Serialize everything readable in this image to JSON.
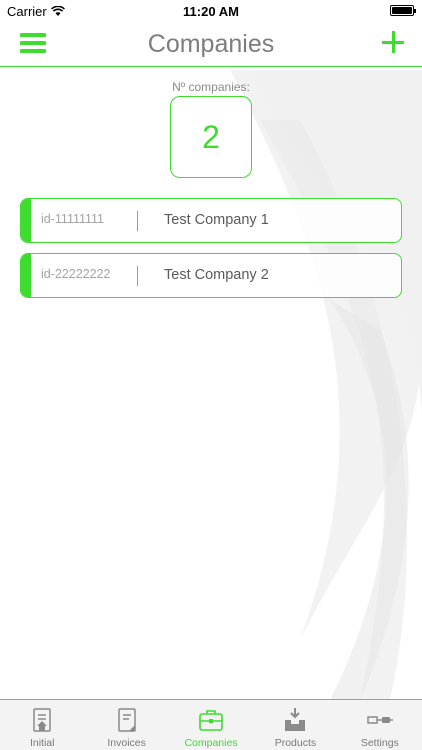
{
  "status_bar": {
    "carrier": "Carrier",
    "time": "11:20 AM"
  },
  "header": {
    "title": "Companies"
  },
  "counter": {
    "label": "Nº companies:",
    "value": "2"
  },
  "companies": [
    {
      "id": "id-11111111",
      "name": "Test Company 1"
    },
    {
      "id": "id-22222222",
      "name": "Test Company 2"
    }
  ],
  "tabs": [
    {
      "label": "Initial",
      "icon": "initial-icon"
    },
    {
      "label": "Invoices",
      "icon": "invoices-icon"
    },
    {
      "label": "Companies",
      "icon": "briefcase-icon",
      "active": true
    },
    {
      "label": "Products",
      "icon": "products-icon"
    },
    {
      "label": "Settings",
      "icon": "settings-icon"
    }
  ],
  "colors": {
    "accent": "#3ddc2f",
    "title": "#7d7d7d",
    "tab_bar_bg": "#f3f3f3"
  }
}
